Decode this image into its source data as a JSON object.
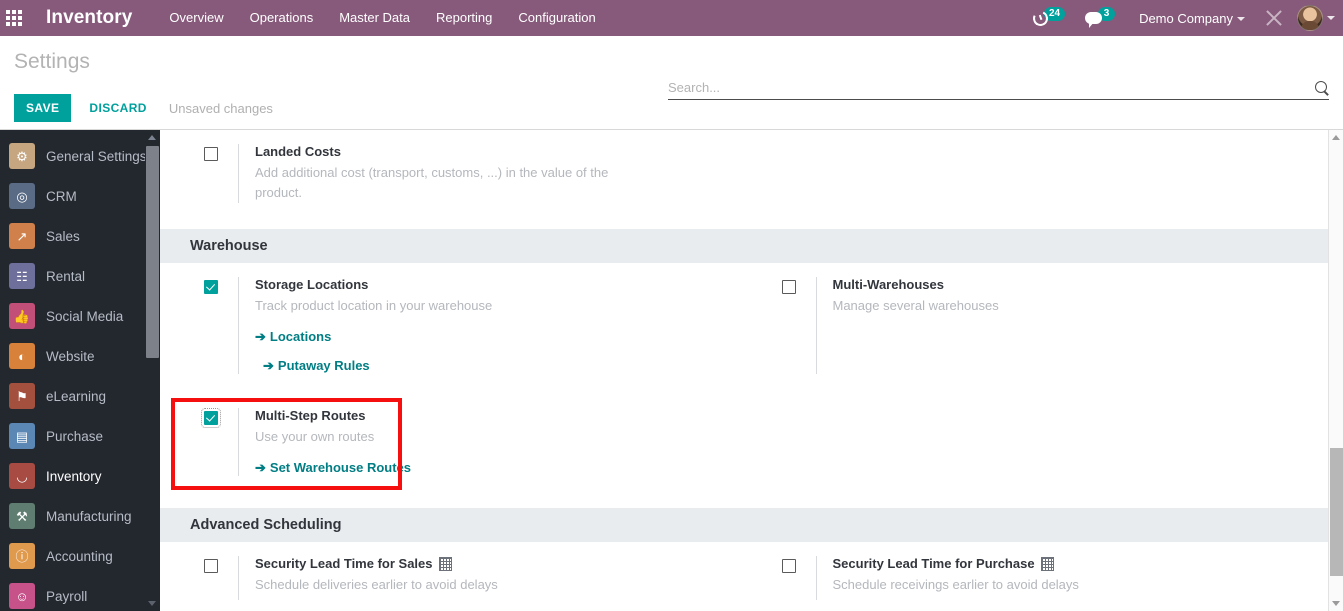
{
  "navbar": {
    "apps_icon": "apps-grid-icon",
    "brand": "Inventory",
    "menus": [
      "Overview",
      "Operations",
      "Master Data",
      "Reporting",
      "Configuration"
    ],
    "activity_icon": "clock-icon",
    "activity_count": "24",
    "messaging_icon": "chat-icon",
    "messaging_count": "3",
    "company": "Demo Company",
    "tools_icon": "wrench-icon",
    "avatar_icon": "user-avatar",
    "bg_color": "#875A7B",
    "badge_color": "#00A09D"
  },
  "control_panel": {
    "breadcrumb": "Settings",
    "save_label": "SAVE",
    "discard_label": "DISCARD",
    "status": "Unsaved changes",
    "search_placeholder": "Search...",
    "search_value": "",
    "search_icon": "search-icon",
    "accent_color": "#00A09D"
  },
  "sidebar": {
    "items": [
      {
        "label": "General Settings",
        "icon": "gear-icon",
        "glyph": "⚙",
        "color": "#c6a681"
      },
      {
        "label": "CRM",
        "icon": "handshake-icon",
        "glyph": "◎",
        "color": "#5a6b86"
      },
      {
        "label": "Sales",
        "icon": "chart-line-icon",
        "glyph": "↗",
        "color": "#d0804a"
      },
      {
        "label": "Rental",
        "icon": "calendar-icon",
        "glyph": "☷",
        "color": "#6e6f9b"
      },
      {
        "label": "Social Media",
        "icon": "thumbs-up-icon",
        "glyph": "☝",
        "color": "#c24f78"
      },
      {
        "label": "Website",
        "icon": "globe-icon",
        "glyph": "◔",
        "color": "#d8813a"
      },
      {
        "label": "eLearning",
        "icon": "graduation-icon",
        "glyph": "⚑",
        "color": "#a4503f"
      },
      {
        "label": "Purchase",
        "icon": "card-icon",
        "glyph": "▤",
        "color": "#5b87b5"
      },
      {
        "label": "Inventory",
        "icon": "box-icon",
        "glyph": "⛁",
        "color": "#a84b43"
      },
      {
        "label": "Manufacturing",
        "icon": "wrench-icon",
        "glyph": "⚒",
        "color": "#5f7d70"
      },
      {
        "label": "Accounting",
        "icon": "invoice-icon",
        "glyph": "Ⓢ",
        "color": "#e09a4e"
      },
      {
        "label": "Payroll",
        "icon": "people-icon",
        "glyph": "☺",
        "color": "#c7528a"
      }
    ],
    "active": "Inventory",
    "bg_color": "#23272e"
  },
  "settings": {
    "landed_costs": {
      "checked": false,
      "title": "Landed Costs",
      "desc": "Add additional cost (transport, customs, ...) in the value of the product."
    },
    "sections": [
      {
        "title": "Warehouse",
        "rows": [
          {
            "left": {
              "checked": true,
              "title": "Storage Locations",
              "desc": "Track product location in your warehouse",
              "links": [
                "Locations",
                "Putaway Rules"
              ]
            },
            "right": {
              "checked": false,
              "title": "Multi-Warehouses",
              "desc": "Manage several warehouses",
              "links": []
            }
          },
          {
            "left": {
              "checked": true,
              "highlighted": true,
              "title": "Multi-Step Routes",
              "desc": "Use your own routes",
              "links": [
                "Set Warehouse Routes"
              ]
            },
            "right": null
          }
        ]
      },
      {
        "title": "Advanced Scheduling",
        "rows": [
          {
            "left": {
              "checked": false,
              "title": "Security Lead Time for Sales",
              "company_icon": true,
              "desc": "Schedule deliveries earlier to avoid delays",
              "links": []
            },
            "right": {
              "checked": false,
              "title": "Security Lead Time for Purchase",
              "company_icon": true,
              "desc": "Schedule receivings earlier to avoid delays",
              "links": []
            }
          }
        ]
      }
    ],
    "highlight_color": "#f50f0f",
    "link_color": "#017e84"
  }
}
